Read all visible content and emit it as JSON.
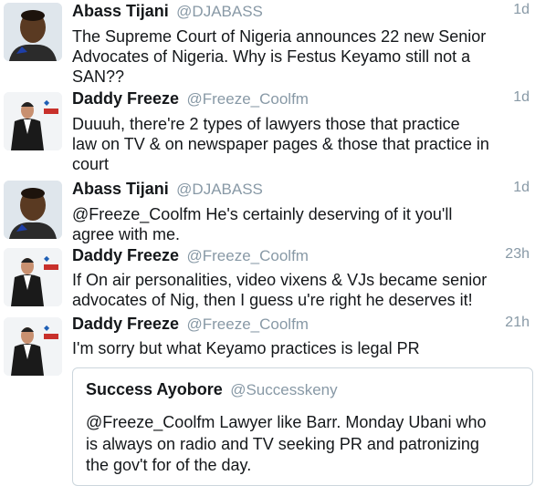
{
  "tweets": [
    {
      "name": "Abass Tijani",
      "handle": "@DJABASS",
      "time": "1d",
      "avatar": "abass-avatar",
      "text": "The Supreme Court of Nigeria announces 22 new Senior\nAdvocates of Nigeria. Why is Festus Keyamo still not a\nSAN??"
    },
    {
      "name": "Daddy Freeze",
      "handle": "@Freeze_Coolfm",
      "time": "1d",
      "avatar": "freeze-avatar",
      "text": "Duuuh, there're 2 types of lawyers those that practice\nlaw on TV & on newspaper pages & those that practice in\ncourt"
    },
    {
      "name": "Abass Tijani",
      "handle": "@DJABASS",
      "time": "1d",
      "avatar": "abass-avatar",
      "text": "@Freeze_Coolfm He's certainly deserving of it you'll\nagree with me."
    },
    {
      "name": "Daddy Freeze",
      "handle": "@Freeze_Coolfm",
      "time": "23h",
      "avatar": "freeze-avatar",
      "text": "If On air personalities, video vixens & VJs became senior\nadvocates of Nig, then I guess u're right he deserves it!"
    },
    {
      "name": "Daddy Freeze",
      "handle": "@Freeze_Coolfm",
      "time": "21h",
      "avatar": "freeze-avatar",
      "text": "I'm sorry but what Keyamo practices is legal PR"
    }
  ],
  "quoted": {
    "name": "Success Ayobore",
    "handle": "@Successkeny",
    "text": "@Freeze_Coolfm Lawyer like Barr. Monday Ubani who\nis always on radio and TV seeking PR and patronizing\nthe gov't for of the day."
  },
  "colors": {
    "text": "#14171a",
    "secondary": "#8899a6",
    "border": "#ccd6dd"
  }
}
